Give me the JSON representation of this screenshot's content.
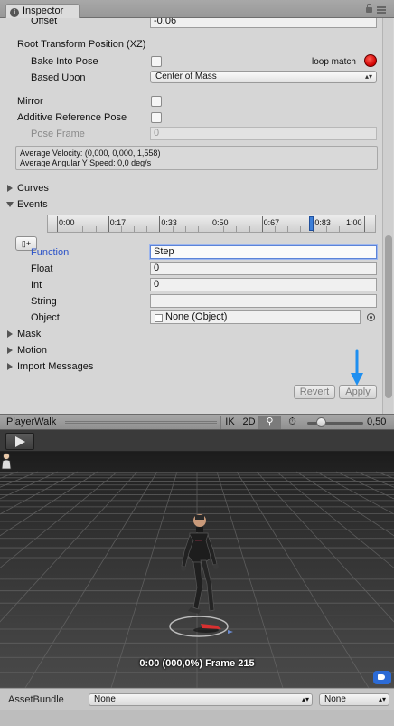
{
  "window": {
    "tab_label": "Inspector"
  },
  "inspector": {
    "offset": {
      "label": "Offset",
      "value": "-0.06"
    },
    "root_transform_position": {
      "header": "Root Transform Position (XZ)",
      "bake_label": "Bake Into Pose",
      "based_upon_label": "Based Upon",
      "based_upon_value": "Center of Mass",
      "loop_match_label": "loop match"
    },
    "mirror_label": "Mirror",
    "additive_label": "Additive Reference Pose",
    "pose_frame": {
      "label": "Pose Frame",
      "value": "0"
    },
    "info": {
      "line1": "Average Velocity: (0,000, 0,000, 1,558)",
      "line2": "Average Angular Y Speed: 0,0 deg/s"
    },
    "curves_label": "Curves",
    "events_label": "Events",
    "timeline": {
      "ticks": [
        "0:00",
        "0:17",
        "0:33",
        "0:50",
        "0:67",
        "0:83",
        "1:00"
      ],
      "event_time": 0.83
    },
    "event": {
      "function_label": "Function",
      "function_value": "Step",
      "float_label": "Float",
      "float_value": "0",
      "int_label": "Int",
      "int_value": "0",
      "string_label": "String",
      "string_value": "",
      "object_label": "Object",
      "object_value": "None (Object)"
    },
    "mask_label": "Mask",
    "motion_label": "Motion",
    "import_messages_label": "Import Messages",
    "revert_label": "Revert",
    "apply_label": "Apply"
  },
  "preview": {
    "title": "PlayerWalk",
    "ik_label": "IK",
    "mode_2d_label": "2D",
    "speed": 0.5,
    "speed_label": "0,50",
    "frame_label": "0:00 (000,0%) Frame 215"
  },
  "asset_bundle": {
    "label": "AssetBundle",
    "name_value": "None",
    "variant_value": "None"
  },
  "colors": {
    "record": "#e00000",
    "event_marker": "#3d7fd8",
    "focus": "#5b83d8",
    "annotation_arrow": "#1e8ff0"
  },
  "icons": [
    "info-icon",
    "lock-icon",
    "menu-icon",
    "add-event-icon",
    "object-picker-icon",
    "play-icon",
    "pivot-icon",
    "speed-icon",
    "avatar-icon",
    "tag-icon"
  ]
}
